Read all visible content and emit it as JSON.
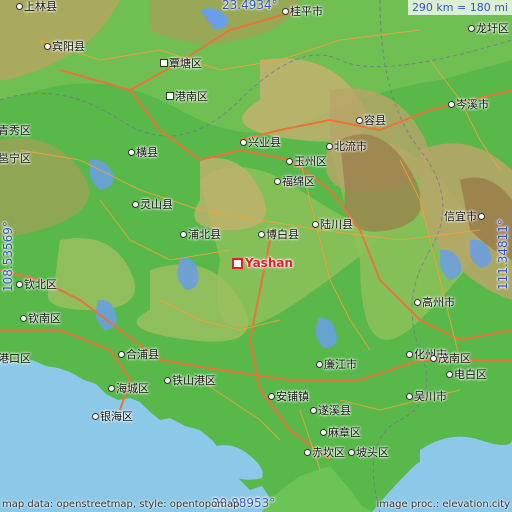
{
  "colors": {
    "sea": "#8cc8e8",
    "lowland": "#58b84a",
    "midland": "#8dc05a",
    "upland": "#c8b070",
    "mountain": "#9a7a4a",
    "water": "#6a9ee8",
    "road": "#f2a23a",
    "highway": "#e8743a",
    "marker": "#e0202a",
    "coord_text": "#3355bb"
  },
  "marker": {
    "label": "Yashan"
  },
  "coords": {
    "top": "23.4934°",
    "bottom": "20.88953°",
    "left": "108.53569°",
    "right": "111.34811°"
  },
  "scale": {
    "text": "290 km = 180 mi"
  },
  "credits": {
    "left": "map data: openstreetmap, style: opentopomap",
    "right": "image proc.: elevation.city"
  },
  "places": [
    {
      "id": "shanglinxian",
      "name": "上林县"
    },
    {
      "id": "binyangxian",
      "name": "宾阳县"
    },
    {
      "id": "qintangqu",
      "name": "覃塘区"
    },
    {
      "id": "gangnanqu",
      "name": "港南区"
    },
    {
      "id": "guipingshi",
      "name": "桂平市"
    },
    {
      "id": "longxuqu",
      "name": "龙圩区"
    },
    {
      "id": "cenxishi",
      "name": "岑溪市"
    },
    {
      "id": "qingxiuqu",
      "name": "青秀区"
    },
    {
      "id": "yongningqu",
      "name": "邕宁区"
    },
    {
      "id": "hengxian",
      "name": "横县"
    },
    {
      "id": "xingyexian",
      "name": "兴业县"
    },
    {
      "id": "rongxian",
      "name": "容县"
    },
    {
      "id": "yuzhouqu",
      "name": "玉州区"
    },
    {
      "id": "beiliushi",
      "name": "北流市"
    },
    {
      "id": "fumianqu",
      "name": "福绵区"
    },
    {
      "id": "lingshanxian",
      "name": "灵山县"
    },
    {
      "id": "xinyishi",
      "name": "信宜市"
    },
    {
      "id": "pubeixian",
      "name": "浦北县"
    },
    {
      "id": "bobaixian",
      "name": "博白县"
    },
    {
      "id": "luchuanxian",
      "name": "陆川县"
    },
    {
      "id": "qinbeiqu",
      "name": "钦北区"
    },
    {
      "id": "gaozhoushi",
      "name": "高州市"
    },
    {
      "id": "qinnanqu",
      "name": "钦南区"
    },
    {
      "id": "hepuxian",
      "name": "合浦县"
    },
    {
      "id": "lianjiangshi",
      "name": "廉江市"
    },
    {
      "id": "huazhoushi",
      "name": "化州市"
    },
    {
      "id": "maonanqu",
      "name": "茂南区"
    },
    {
      "id": "dianbaiqu",
      "name": "电白区"
    },
    {
      "id": "haichengqu",
      "name": "海城区"
    },
    {
      "id": "tieshangangqu",
      "name": "铁山港区"
    },
    {
      "id": "anpuzhen",
      "name": "安铺镇"
    },
    {
      "id": "wuchuanshi",
      "name": "吴川市"
    },
    {
      "id": "yinhaiqu",
      "name": "银海区"
    },
    {
      "id": "suixixian",
      "name": "遂溪县"
    },
    {
      "id": "mazhangqu",
      "name": "麻章区"
    },
    {
      "id": "chikanqu",
      "name": "赤坎区"
    },
    {
      "id": "potouqu",
      "name": "坡头区"
    },
    {
      "id": "gangchengqu",
      "name": "港口区"
    }
  ]
}
